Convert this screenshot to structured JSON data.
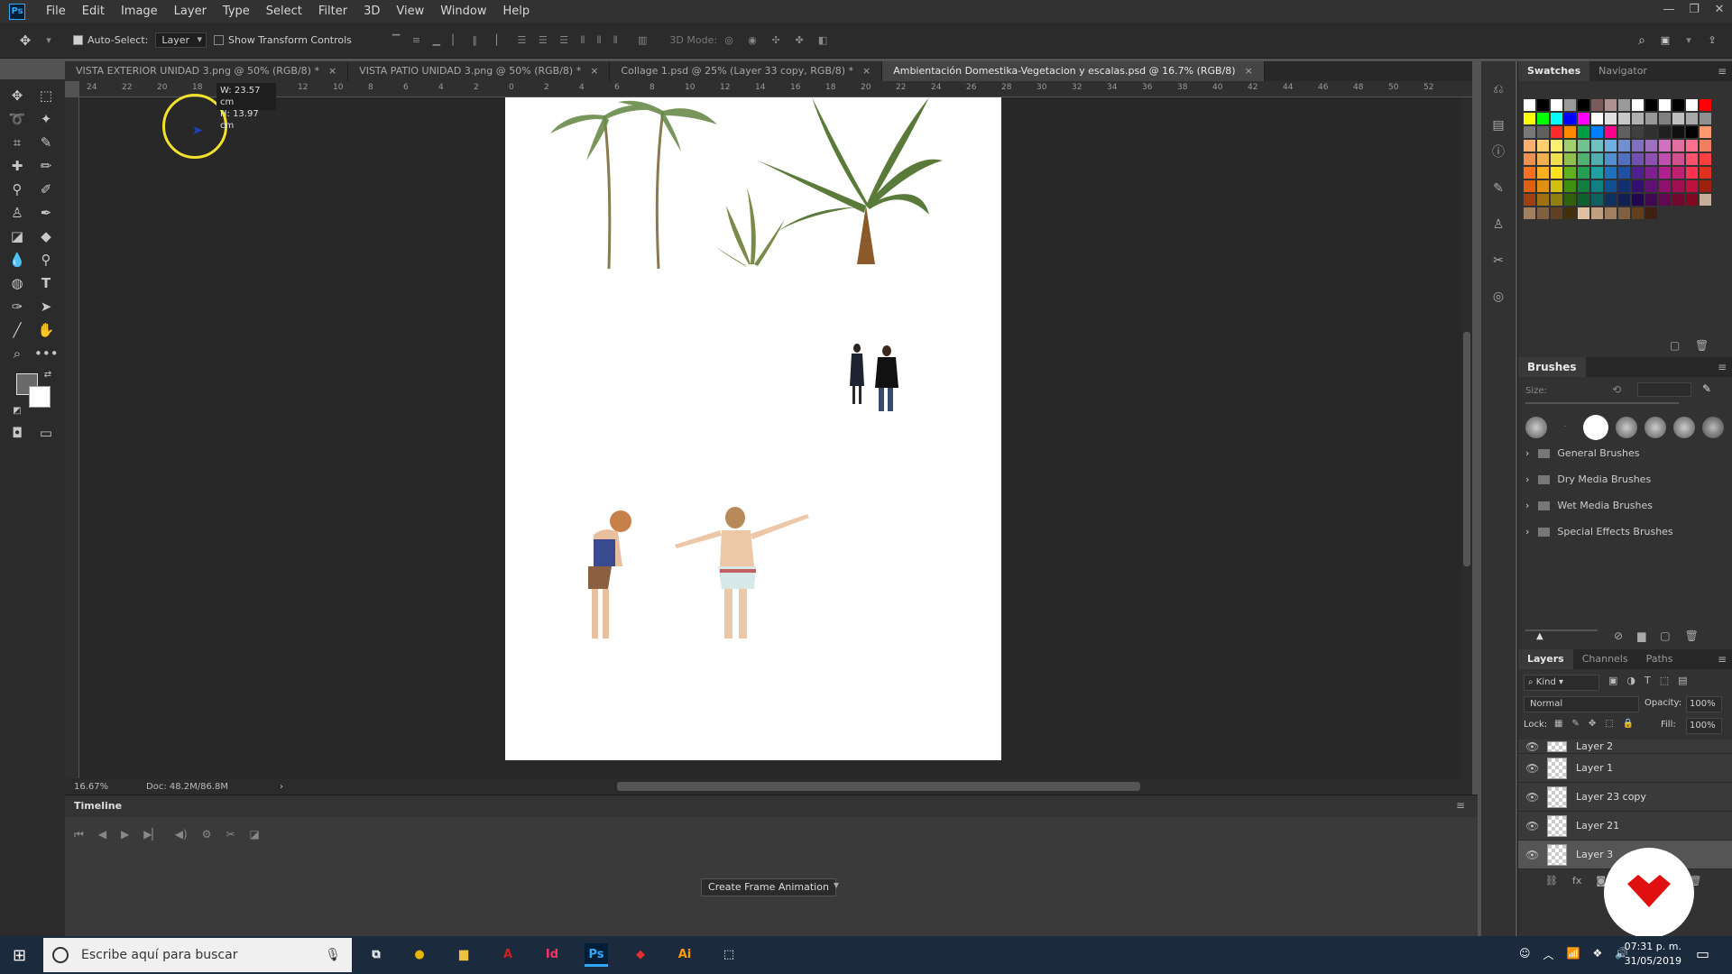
{
  "menu": [
    "File",
    "Edit",
    "Image",
    "Layer",
    "Type",
    "Select",
    "Filter",
    "3D",
    "View",
    "Window",
    "Help"
  ],
  "app_logo": "Ps",
  "window_controls": [
    "—",
    "❐",
    "✕"
  ],
  "options": {
    "auto_select_label": "Auto-Select:",
    "auto_select_value": "Layer",
    "transform_label": "Show Transform Controls",
    "mode_3d_label": "3D Mode:"
  },
  "tabs": [
    {
      "label": "VISTA EXTERIOR UNIDAD 3.png @ 50% (RGB/8) *",
      "active": false
    },
    {
      "label": "VISTA PATIO UNIDAD 3.png @ 50% (RGB/8) *",
      "active": false
    },
    {
      "label": "Collage 1.psd @ 25% (Layer 33 copy, RGB/8) *",
      "active": false
    },
    {
      "label": "Ambientación Domestika-Vegetacion y escalas.psd @ 16.7% (RGB/8)",
      "active": true
    }
  ],
  "ruler_ticks": [
    "24",
    "22",
    "20",
    "18",
    "16",
    "14",
    "12",
    "10",
    "8",
    "6",
    "4",
    "2",
    "0",
    "2",
    "4",
    "6",
    "8",
    "10",
    "12",
    "14",
    "16",
    "18",
    "20",
    "22",
    "24",
    "26",
    "28",
    "30",
    "32",
    "34",
    "36",
    "38",
    "40",
    "42",
    "44",
    "46",
    "48",
    "50",
    "52"
  ],
  "tooltip": {
    "w": "W: 23.57 cm",
    "h": "H: 13.97 cm"
  },
  "status": {
    "zoom": "16.67%",
    "doc": "Doc: 48.2M/86.8M"
  },
  "timeline": {
    "title": "Timeline",
    "create_label": "Create Frame Animation"
  },
  "panels": {
    "swatch_tabs": [
      "Swatches",
      "Navigator"
    ],
    "swatch_colors": [
      "#ffffff",
      "#000000",
      "#ffffff",
      "#9a9a9a",
      "#000000",
      "#7a5a5a",
      "#b09090",
      "#9a9a9a",
      "#ffffff",
      "#000000",
      "#ffffff",
      "#000000",
      "#ffffff",
      "#ff0000",
      "#ffff00",
      "#00ff00",
      "#00ffff",
      "#0000ff",
      "#ff00ff",
      "#ffffff",
      "#e0e0e0",
      "#c8c8c8",
      "#b0b0b0",
      "#989898",
      "#808080",
      "#c0c0c0",
      "#a8a8a8",
      "#909090",
      "#787878",
      "#606060",
      "#ff2a2a",
      "#ff8a00",
      "#00a040",
      "#0080ff",
      "#ff0088",
      "#606060",
      "#404040",
      "#303030",
      "#202020",
      "#101010",
      "#000000",
      "#ff9a70",
      "#ffb070",
      "#ffd070",
      "#fff070",
      "#a0d070",
      "#70c090",
      "#70c0c0",
      "#70b0e0",
      "#7090d0",
      "#8070c0",
      "#a070c0",
      "#d070c0",
      "#e070a0",
      "#ff7090",
      "#f08060",
      "#f09050",
      "#f0b050",
      "#f0e050",
      "#90c050",
      "#50b070",
      "#50b0b0",
      "#5090d0",
      "#5070c0",
      "#7050b0",
      "#9050b0",
      "#c050b0",
      "#d05090",
      "#ff5070",
      "#ff4040",
      "#ff7020",
      "#ffb020",
      "#ffe020",
      "#60b020",
      "#20a050",
      "#20a0a0",
      "#2070c0",
      "#2050a0",
      "#502090",
      "#802090",
      "#b02090",
      "#c02070",
      "#ff3050",
      "#e03020",
      "#e06010",
      "#e09010",
      "#d0c010",
      "#409010",
      "#108040",
      "#108080",
      "#105090",
      "#103070",
      "#301070",
      "#601070",
      "#901070",
      "#a01050",
      "#c01040",
      "#a02010",
      "#a04010",
      "#a07010",
      "#908010",
      "#306010",
      "#106030",
      "#106060",
      "#103060",
      "#102050",
      "#200850",
      "#400850",
      "#600850",
      "#700830",
      "#800820",
      "#c8b098",
      "#a08060",
      "#806040",
      "#604020",
      "#403010",
      "#e0c0a0",
      "#c0a080",
      "#a08060",
      "#806040",
      "#604020",
      "#402010"
    ],
    "brushes_title": "Brushes",
    "brush_size_label": "Size:",
    "brush_folders": [
      "General Brushes",
      "Dry Media Brushes",
      "Wet Media Brushes",
      "Special Effects Brushes"
    ],
    "layers_tabs": [
      "Layers",
      "Channels",
      "Paths"
    ],
    "kind_label": "Kind",
    "blend_mode": "Normal",
    "opacity_label": "Opacity:",
    "opacity_value": "100%",
    "lock_label": "Lock:",
    "fill_label": "Fill:",
    "fill_value": "100%",
    "layers": [
      "Layer 2",
      "Layer 1",
      "Layer 23 copy",
      "Layer 21",
      "Layer 3"
    ]
  },
  "taskbar": {
    "search_placeholder": "Escribe aquí para buscar",
    "time": "07:31 p. m.",
    "date": "31/05/2019",
    "apps": [
      {
        "name": "chrome-icon",
        "label": "●",
        "color": "#e8b400"
      },
      {
        "name": "file-explorer-icon",
        "label": "▆",
        "color": "#f0c040"
      },
      {
        "name": "acrobat-icon",
        "label": "A",
        "color": "#d02020"
      },
      {
        "name": "indesign-icon",
        "label": "Id",
        "color": "#ff3366"
      },
      {
        "name": "photoshop-icon",
        "label": "Ps",
        "color": "#31a8ff"
      },
      {
        "name": "sketchup-icon",
        "label": "◆",
        "color": "#e03030"
      },
      {
        "name": "illustrator-icon",
        "label": "Ai",
        "color": "#ff9a00"
      },
      {
        "name": "snipping-icon",
        "label": "⬚",
        "color": "#ffffff"
      }
    ]
  },
  "colors": {
    "accent": "#31a8ff",
    "cursor_ring": "#f2e12a",
    "logo_red": "#e01010"
  }
}
